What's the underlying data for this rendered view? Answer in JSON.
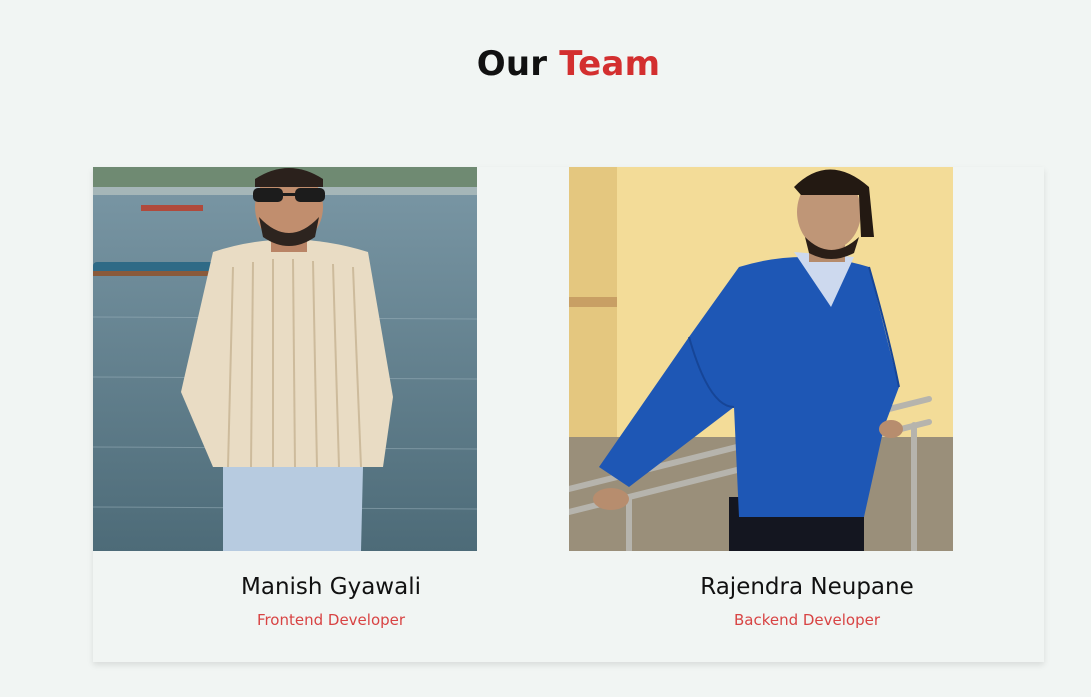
{
  "header": {
    "title_part1": "Our",
    "title_part2": "Team",
    "accent_color": "#d32f2f"
  },
  "members": [
    {
      "name": "Manish Gyawali",
      "role": "Frontend Developer"
    },
    {
      "name": "Rajendra Neupane",
      "role": "Backend Developer"
    }
  ],
  "colors": {
    "background": "#f1f5f3",
    "role_text": "#d84343"
  }
}
